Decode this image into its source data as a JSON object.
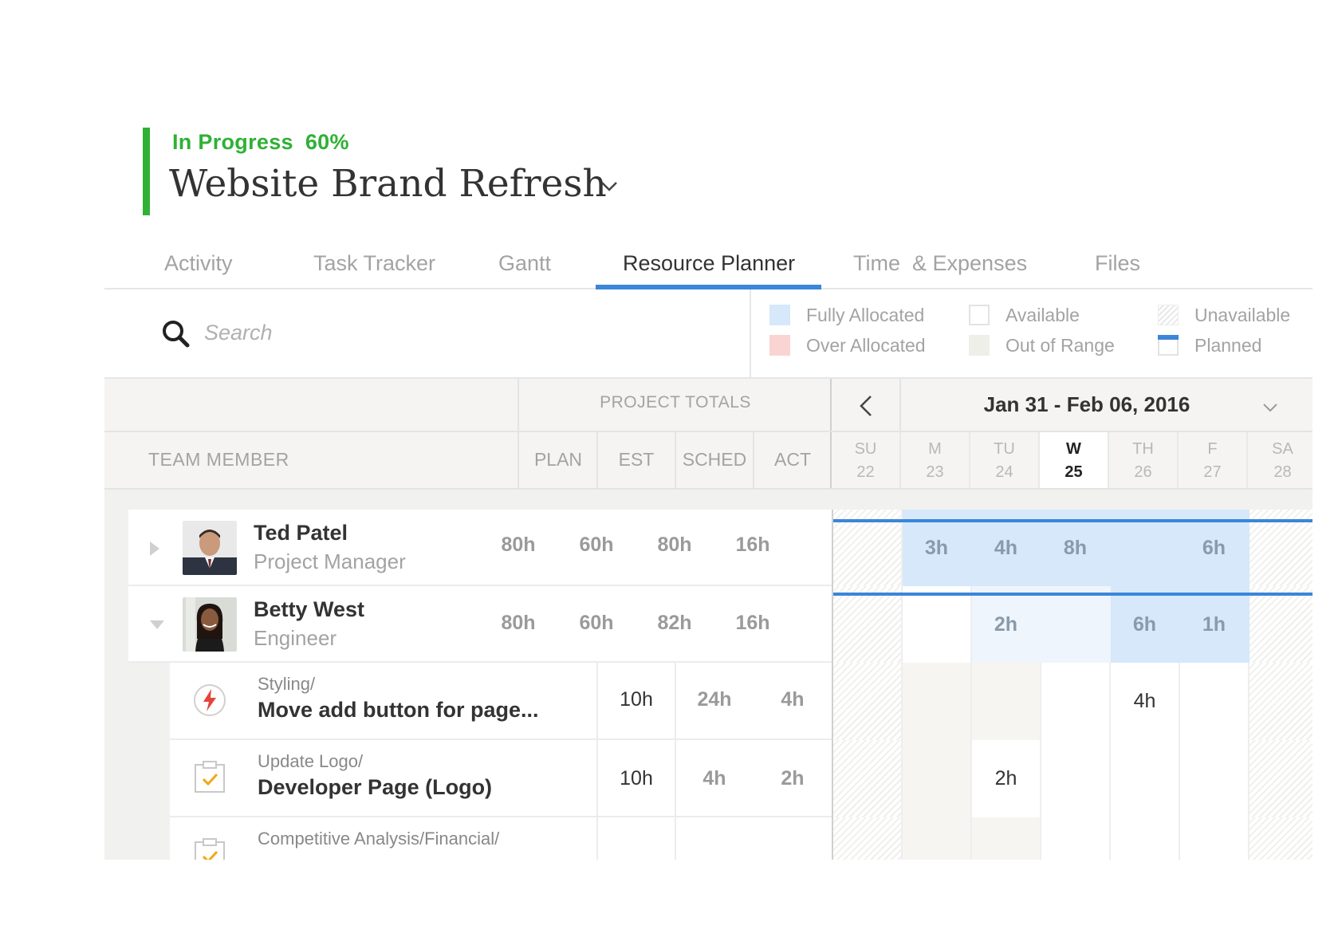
{
  "project": {
    "status_label": "In Progress",
    "status_percent": "60%",
    "progress_value": 0.6,
    "title": "Website Brand Refresh",
    "status_color": "#2fb135"
  },
  "tabs": [
    {
      "label": "Activity",
      "active": false
    },
    {
      "label": "Task Tracker",
      "active": false
    },
    {
      "label": "Gantt",
      "active": false
    },
    {
      "label": "Resource Planner",
      "active": true
    },
    {
      "label": "Time  & Expenses",
      "active": false
    },
    {
      "label": "Files",
      "active": false
    }
  ],
  "search": {
    "placeholder": "Search",
    "value": ""
  },
  "legend": [
    {
      "label": "Fully Allocated",
      "color": "#d6e8fa"
    },
    {
      "label": "Over Allocated",
      "color": "#fad4d2"
    },
    {
      "label": "Available",
      "color": "#ffffff"
    },
    {
      "label": "Out of Range",
      "color": "#efefe9"
    },
    {
      "label": "Unavailable",
      "color": "hatched"
    },
    {
      "label": "Planned",
      "color": "#3b86d9"
    }
  ],
  "table": {
    "project_totals_label": "PROJECT TOTALS",
    "team_member_label": "TEAM MEMBER",
    "columns": [
      "PLAN",
      "EST",
      "SCHED",
      "ACT"
    ]
  },
  "calendar": {
    "range": "Jan 31 - Feb 06, 2016",
    "days": [
      {
        "dow": "SU",
        "num": "22"
      },
      {
        "dow": "M",
        "num": "23"
      },
      {
        "dow": "TU",
        "num": "24"
      },
      {
        "dow": "W",
        "num": "25",
        "today": true
      },
      {
        "dow": "TH",
        "num": "26"
      },
      {
        "dow": "F",
        "num": "27"
      },
      {
        "dow": "SA",
        "num": "28"
      }
    ]
  },
  "people": [
    {
      "name": "Ted Patel",
      "role": "Project Manager",
      "expanded": false,
      "plan": "80h",
      "est": "60h",
      "sched": "80h",
      "act": "16h",
      "days": [
        "",
        "3h",
        "4h",
        "8h",
        "",
        "6h",
        ""
      ]
    },
    {
      "name": "Betty West",
      "role": "Engineer",
      "expanded": true,
      "plan": "80h",
      "est": "60h",
      "sched": "82h",
      "act": "16h",
      "days": [
        "",
        "",
        "2h",
        "",
        "6h",
        "1h",
        ""
      ]
    }
  ],
  "tasks": [
    {
      "crumb": "Styling/",
      "name": "Move add button for page...",
      "icon": "lightning-icon",
      "est": "10h",
      "sched": "24h",
      "act": "4h",
      "days": [
        "",
        "",
        "",
        "",
        "4h",
        "",
        ""
      ]
    },
    {
      "crumb": "Update Logo/",
      "name": "Developer Page (Logo)",
      "icon": "clipboard-check-icon",
      "est": "10h",
      "sched": "4h",
      "act": "2h",
      "days": [
        "",
        "",
        "2h",
        "",
        "",
        "",
        ""
      ]
    },
    {
      "crumb": "Competitive Analysis/Financial/",
      "name": "",
      "icon": "clipboard-check-icon",
      "est": "",
      "sched": "",
      "act": "",
      "days": [
        "",
        "",
        "",
        "",
        "",
        "",
        ""
      ]
    }
  ]
}
